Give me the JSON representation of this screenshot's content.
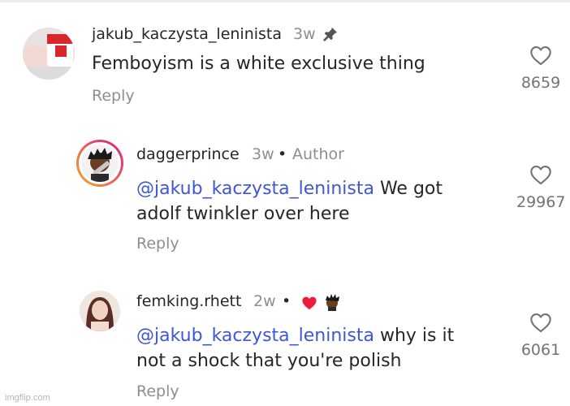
{
  "comments": [
    {
      "username": "jakub_kaczysta_leninista",
      "time": "3w",
      "badge_icon": "pin-icon",
      "text": "Femboyism is a white exclusive thing",
      "reply_label": "Reply",
      "like_count": "8659"
    },
    {
      "username": "daggerprince",
      "time": "3w",
      "separator": "•",
      "author_label": "Author",
      "mention": "@jakub_kaczysta_leninista",
      "text_after_mention": " We got",
      "text_line2": "adolf twinkler over here",
      "reply_label": "Reply",
      "like_count": "29967"
    },
    {
      "username": "femking.rhett",
      "time": "2w",
      "separator": "•",
      "liked_by_author_icon": "red-heart-icon",
      "mention": "@jakub_kaczysta_leninista",
      "text_after_mention": " why is it",
      "text_line2": "not a shock that you're polish",
      "reply_label": "Reply",
      "like_count": "6061"
    }
  ],
  "watermark": "imgflip.com",
  "colors": {
    "mention": "#3d57d6",
    "secondary_text": "#8e8e8e",
    "heart_red": "#ed1c3a",
    "story_ring_start": "#f9a825",
    "story_ring_end": "#d81b8c"
  }
}
